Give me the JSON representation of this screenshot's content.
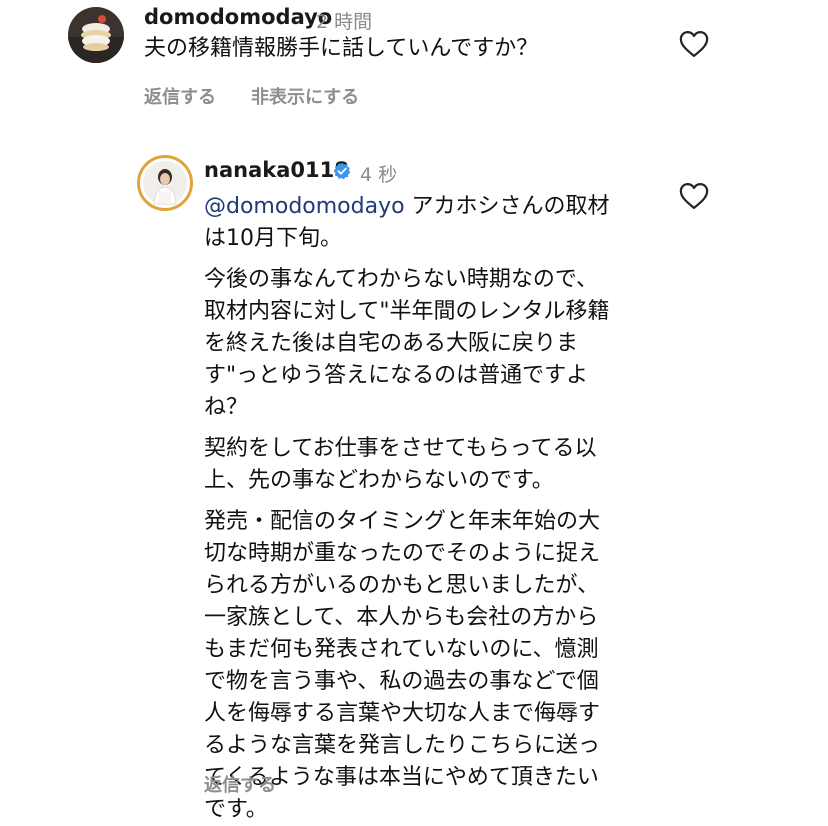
{
  "comment1": {
    "username": "domodomodayo",
    "time": "2 時間",
    "text": "夫の移籍情報勝手に話していんですか？",
    "reply_label": "返信する",
    "hide_label": "非表示にする",
    "icons": {
      "avatar": "avatar-image",
      "like": "heart-outline-icon"
    }
  },
  "reply": {
    "username": "nanaka0118",
    "time": "4 秒",
    "mention": "@domodomodayo",
    "first_line_rest": " アカホシさんの取材",
    "line2": "は10月下旬。",
    "para2": [
      "今後の事なんてわからない時期なので、",
      "取材内容に対して\"半年間のレンタル移籍",
      "を終えた後は自宅のある大阪に戻りま",
      "す\"っとゆう答えになるのは普通ですよ",
      "ね？"
    ],
    "para3": [
      "契約をしてお仕事をさせてもらってる以",
      "上、先の事などわからないのです。"
    ],
    "para4": [
      "発売・配信のタイミングと年末年始の大",
      "切な時期が重なったのでそのように捉え",
      "られる方がいるのかもと思いましたが、",
      "一家族として、本人からも会社の方から",
      "もまだ何も発表されていないのに、憶測",
      "で物を言う事や、私の過去の事などで個",
      "人を侮辱する言葉や大切な人まで侮辱す",
      "るような言葉を発言したりこちらに送っ",
      "てくるような事は本当にやめて頂きたい",
      "です。"
    ],
    "reply_label": "返信する",
    "icons": {
      "avatar": "avatar-image",
      "verified": "verified-badge-icon",
      "like": "heart-outline-icon"
    },
    "colors": {
      "mention": "#1f3b76",
      "verified": "#3897f0",
      "story_ring": "#e0a43a"
    }
  }
}
